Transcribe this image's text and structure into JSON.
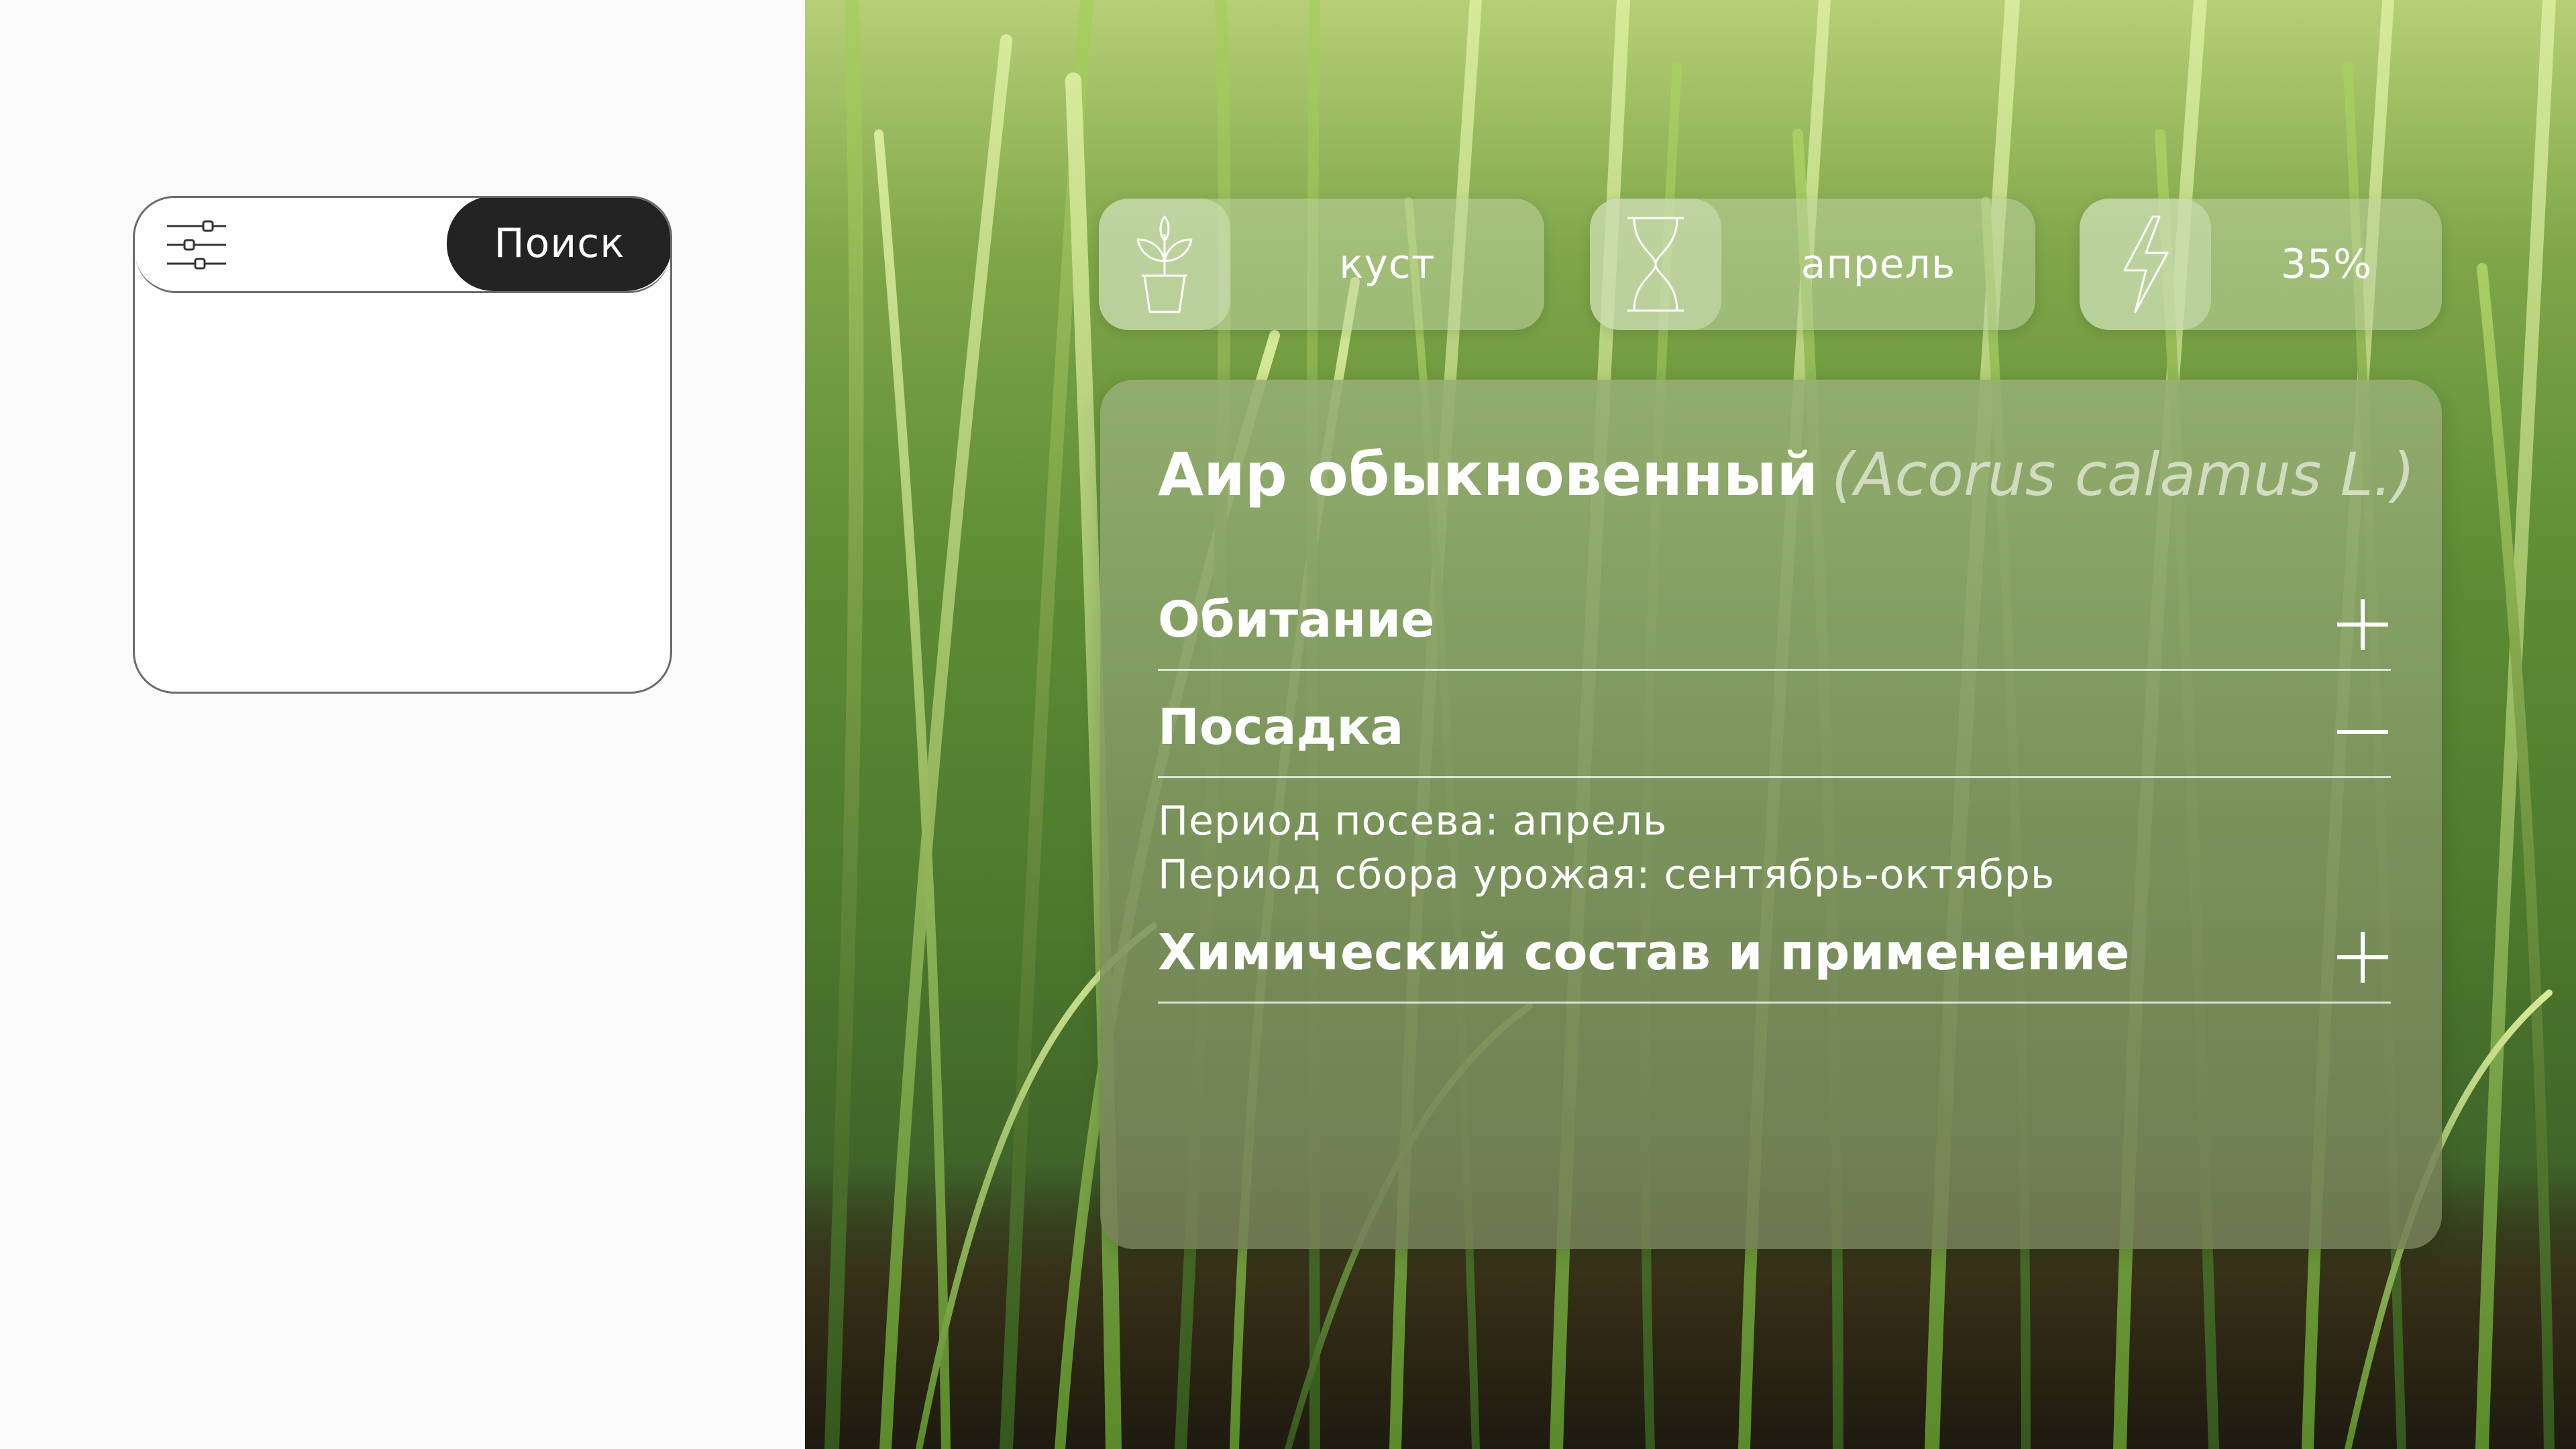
{
  "search": {
    "filter_icon": "sliders-icon",
    "button_label": "Поиск"
  },
  "tags": [
    {
      "icon": "potted-plant-icon",
      "label": "куст"
    },
    {
      "icon": "hourglass-icon",
      "label": "апрель"
    },
    {
      "icon": "lightning-icon",
      "label": "35%"
    }
  ],
  "plant": {
    "name": "Аир обыкновенный",
    "latin": "(Acorus calamus L.)"
  },
  "sections": [
    {
      "title": "Обитание",
      "state": "collapsed",
      "toggle_icon": "plus-icon"
    },
    {
      "title": "Посадка",
      "state": "expanded",
      "toggle_icon": "minus-icon",
      "content": [
        "Период посева: апрель",
        "Период сбора урожая: сентябрь-октябрь"
      ]
    },
    {
      "title": "Химический состав и применение",
      "state": "collapsed",
      "toggle_icon": "plus-icon"
    }
  ],
  "colors": {
    "search_button": "#232323",
    "card_tint": "#96af73"
  }
}
